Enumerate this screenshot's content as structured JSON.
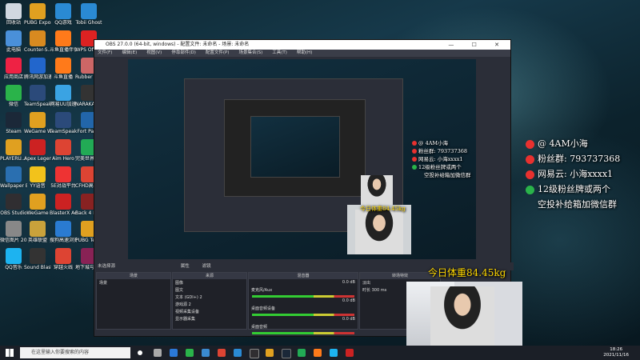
{
  "desktop": {
    "left_icons": [
      {
        "label": "回收站",
        "color": "#d0d8e0"
      },
      {
        "label": "此电脑",
        "color": "#4a90d9"
      },
      {
        "label": "应用商店",
        "color": "#e24"
      },
      {
        "label": "微信",
        "color": "#2ab34a"
      },
      {
        "label": "Steam",
        "color": "#1b2838"
      },
      {
        "label": "PLAYERU... BATTLEGR...",
        "color": "#e0a020"
      },
      {
        "label": "Wallpaper Engine...",
        "color": "#2a6fb0"
      },
      {
        "label": "OBS Studio",
        "color": "#302e31"
      },
      {
        "label": "微信图片 20210...",
        "color": "#888"
      },
      {
        "label": "QQ音乐",
        "color": "#1db3f0"
      }
    ],
    "col2_icons": [
      {
        "label": "PUBG Export...",
        "color": "#e0a020"
      },
      {
        "label": "Counter-S... Global Off...",
        "color": "#d88a20"
      },
      {
        "label": "腾讯网游加速",
        "color": "#2266cc"
      },
      {
        "label": "TeamSpeak 3",
        "color": "#2b4a7a"
      },
      {
        "label": "WeGame WeGame版",
        "color": "#e0a020"
      },
      {
        "label": "Apex Legends",
        "color": "#c22"
      },
      {
        "label": "YY语音",
        "color": "#f2c21b"
      },
      {
        "label": "WeGame",
        "color": "#e0a020"
      },
      {
        "label": "英雄联盟",
        "color": "#c9a23b"
      },
      {
        "label": "Sound Blaster...",
        "color": "#333"
      }
    ],
    "col3_icons": [
      {
        "label": "QQ游戏",
        "color": "#2a8ad4"
      },
      {
        "label": "斗鱼直播伴侣",
        "color": "#ff7a1a"
      },
      {
        "label": "斗鱼直播",
        "color": "#ff7a1a"
      },
      {
        "label": "网易UU加速",
        "color": "#3aa3e3"
      },
      {
        "label": "TeamSpeak",
        "color": "#2b4a7a"
      },
      {
        "label": "Aim Hero",
        "color": "#d43"
      },
      {
        "label": "5E对战平台",
        "color": "#e33"
      },
      {
        "label": "BlasterX Acoustic...",
        "color": "#c22"
      },
      {
        "label": "搜狗高速浏览器",
        "color": "#2a7bd1"
      },
      {
        "label": "穿越火线",
        "color": "#d43"
      }
    ],
    "col4_icons": [
      {
        "label": "Tobii Ghost",
        "color": "#2a8ad4"
      },
      {
        "label": "WPS Office",
        "color": "#d22"
      },
      {
        "label": "Rubber Bandits",
        "color": "#c66"
      },
      {
        "label": "NARAKA BLADEPO...",
        "color": "#333"
      },
      {
        "label": "Fort Party",
        "color": "#26a"
      },
      {
        "label": "完美世界竞技平台",
        "color": "#2a5"
      },
      {
        "label": "CFHD高清竞技",
        "color": "#d43"
      },
      {
        "label": "Back 4 Blood",
        "color": "#822"
      },
      {
        "label": "PUBG Test Server",
        "color": "#e0a020"
      },
      {
        "label": "地下城与勇士",
        "color": "#825"
      }
    ]
  },
  "obs": {
    "title": "OBS 27.0.0 (64-bit, windows) - 配置文件: 未命名 - 场景: 未命名",
    "window_controls": "—  ☐  ✕",
    "menu": [
      "文件(F)",
      "编辑(E)",
      "视图(V)",
      "停靠部件(D)",
      "配置文件(P)",
      "场景集合(S)",
      "工具(T)",
      "帮助(H)"
    ],
    "no_source_selected": "未选择源",
    "properties": "属性",
    "filters": "滤镜",
    "scenes_header": "场景",
    "sources_header": "来源",
    "mixer_header": "混音器",
    "transitions_header": "转场特效",
    "scenes": [
      "场景"
    ],
    "sources": [
      "图像",
      "图文",
      "文本 (GDI+) 2",
      "游戏源 2",
      "视频采集设备",
      "显示器采集"
    ],
    "mixer_channels": [
      {
        "name": "麦克风/Aux",
        "db": "0.0 dB"
      },
      {
        "name": "桌面音频设备",
        "db": "0.0 dB"
      },
      {
        "name": "桌面音频",
        "db": "0.0 dB"
      }
    ],
    "transition": "淡出",
    "duration_label": "时长",
    "duration_value": "300 ms",
    "status": "LIVE: 00:00:00  REC: 00:00:00  CPU: 2.3%, 60.00 fps"
  },
  "overlay": {
    "lines": [
      {
        "icon_color": "#e8312f",
        "text": "@ 4AM小海"
      },
      {
        "icon_color": "#e8312f",
        "text": "粉丝群: 793737368"
      },
      {
        "icon_color": "#e8312f",
        "text": "网易云: 小海xxxx1"
      },
      {
        "icon_color": "#2ab34a",
        "text": "12级粉丝牌或两个"
      },
      {
        "icon_color": "",
        "text": "空投补给箱加微信群"
      }
    ],
    "weight": "今日体重84.45kg"
  },
  "taskbar": {
    "search_placeholder": "在这里输入你要搜索的内容",
    "time": "18:26",
    "date": "2021/11/16"
  }
}
